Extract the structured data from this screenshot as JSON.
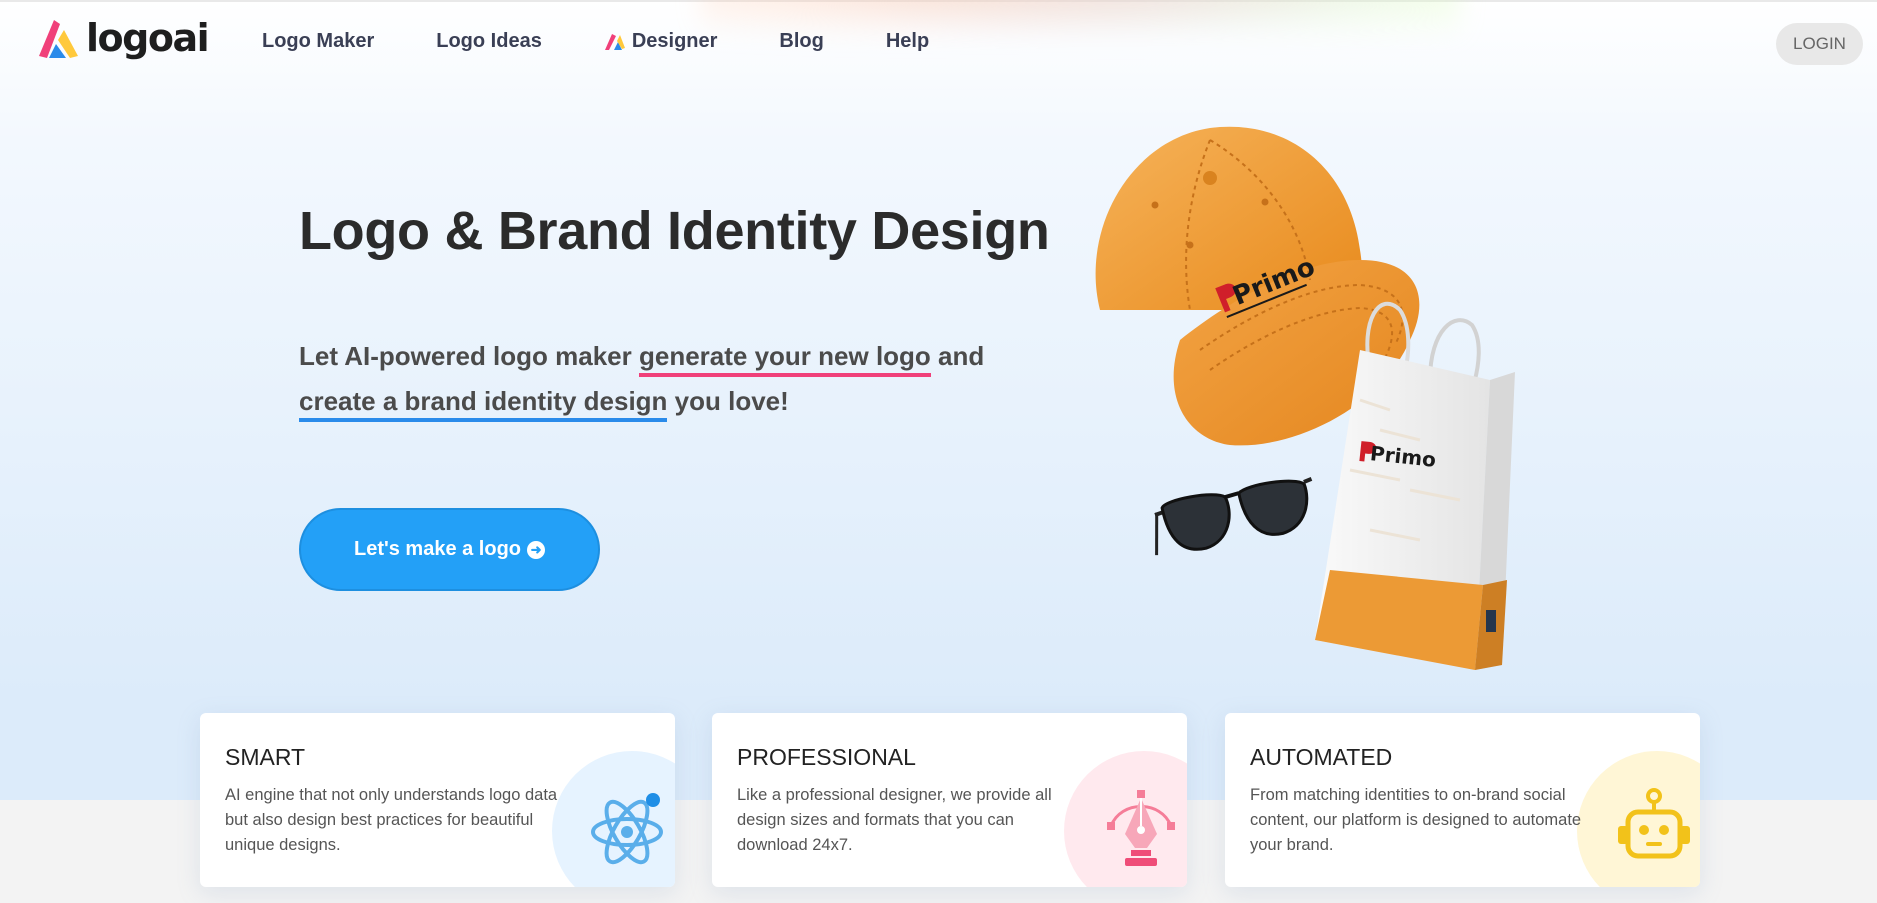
{
  "brand": {
    "name": "logoai"
  },
  "nav": {
    "items": [
      {
        "label": "Logo Maker"
      },
      {
        "label": "Logo Ideas"
      },
      {
        "label": "Designer"
      },
      {
        "label": "Blog"
      },
      {
        "label": "Help"
      }
    ],
    "login_label": "LOGIN"
  },
  "hero": {
    "title": "Logo & Brand Identity Design",
    "subtitle_part1": "Let AI-powered logo maker ",
    "subtitle_highlight1": "generate your new logo",
    "subtitle_part2": " and ",
    "subtitle_highlight2": "create a brand identity design",
    "subtitle_part3": " you love!",
    "cta_label": "Let's make a logo"
  },
  "mockups": {
    "cap_brand": "Primo",
    "bag_brand": "Primo"
  },
  "features": [
    {
      "title": "SMART",
      "description": "AI engine that not only understands logo data but also design best practices for beautiful unique designs.",
      "icon": "atom-icon",
      "circle_color": "#e6f3ff"
    },
    {
      "title": "PROFESSIONAL",
      "description": "Like a professional designer, we provide all design sizes and formats that you can download 24x7.",
      "icon": "pen-tool-icon",
      "circle_color": "#ffe9ee"
    },
    {
      "title": "AUTOMATED",
      "description": "From matching identities to on-brand social content, our platform is designed to automate your brand.",
      "icon": "robot-icon",
      "circle_color": "#fff6d6"
    }
  ],
  "colors": {
    "accent_blue": "#23a0f7",
    "underline_pink": "#f0407a",
    "underline_blue": "#2a8bea",
    "cap_orange": "#f0a040"
  }
}
